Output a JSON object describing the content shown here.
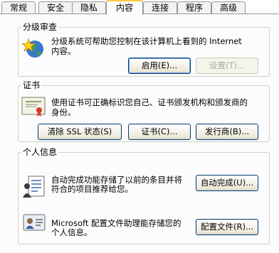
{
  "tabs": [
    {
      "label": "常规",
      "active": false
    },
    {
      "label": "安全",
      "active": false
    },
    {
      "label": "隐私",
      "active": false
    },
    {
      "label": "内容",
      "active": true
    },
    {
      "label": "连接",
      "active": false
    },
    {
      "label": "程序",
      "active": false
    },
    {
      "label": "高级",
      "active": false
    }
  ],
  "content_advisor": {
    "title": "分级审查",
    "icon": "globe-star-icon",
    "desc_line1": "分级系统可帮助您控制在该计算机上看到的 Internet",
    "desc_line2": "内容。",
    "enable_label": "启用(E)...",
    "settings_label": "设置(T)..."
  },
  "certificates": {
    "title": "证书",
    "icon": "certificate-icon",
    "desc_line1": "使用证书可正确标识您自己、证书颁发机构和颁发商的",
    "desc_line2": "身份。",
    "clear_ssl_label": "清除 SSL 状态(S)",
    "certificates_label": "证书(C)...",
    "publishers_label": "发行商(B)..."
  },
  "personal_info": {
    "title": "个人信息",
    "autocomplete_icon": "autocomplete-form-icon",
    "autocomplete_desc_line1": "自动完成功能存储了以前的条目并将",
    "autocomplete_desc_line2": "符合的项目推荐给您。",
    "autocomplete_label": "自动完成(U)...",
    "profile_icon": "profile-icon",
    "profile_desc_line1": "Microsoft 配置文件助理能存储您的",
    "profile_desc_line2": "个人信息。",
    "profile_label": "配置文件(R)..."
  },
  "colors": {
    "tab_highlight": "#ffc83c",
    "button_border": "#003c74",
    "group_border": "#d0d0bf",
    "panel_bg": "#fcfcfe"
  }
}
